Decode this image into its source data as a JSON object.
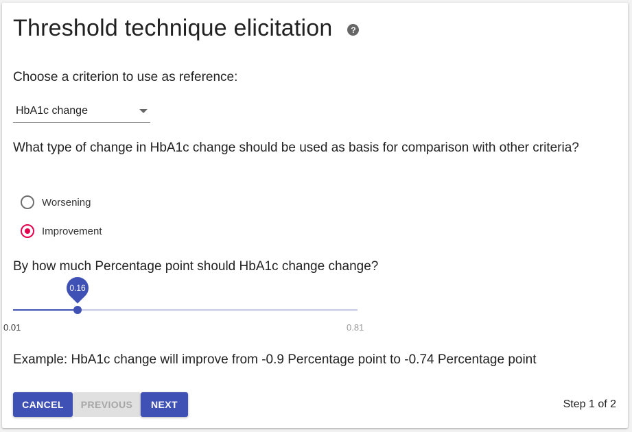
{
  "page": {
    "title": "Threshold technique elicitation",
    "help_icon": "help-circle-icon"
  },
  "reference": {
    "label": "Choose a criterion to use as reference:",
    "selected": "HbA1c change"
  },
  "change_type": {
    "question": "What type of change in HbA1c change should be used as basis for comparison with other criteria?",
    "options": [
      {
        "label": "Worsening",
        "checked": false
      },
      {
        "label": "Improvement",
        "checked": true
      }
    ]
  },
  "amount": {
    "question": "By how much Percentage point should HbA1c change change?",
    "min_label": "0.01",
    "max_label": "0.81",
    "value_label": "0.16",
    "min": 0.01,
    "max": 0.81,
    "value": 0.16
  },
  "example": "Example: HbA1c change will improve from -0.9 Percentage point to -0.74 Percentage point",
  "buttons": {
    "cancel": "Cancel",
    "previous": "Previous",
    "next": "Next"
  },
  "step": "Step 1 of 2",
  "colors": {
    "primary": "#3f51b5",
    "radio_checked": "#e5004e"
  }
}
